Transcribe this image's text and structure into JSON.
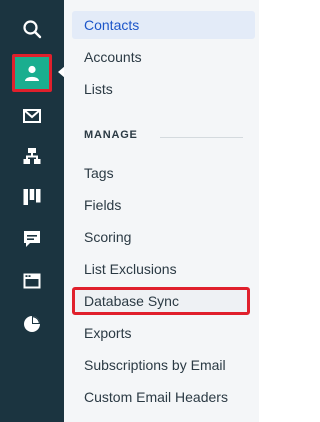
{
  "rail": {
    "icons": [
      "search-icon",
      "contacts-person-icon",
      "mail-icon",
      "automation-tree-icon",
      "deals-columns-icon",
      "chat-message-icon",
      "site-window-icon",
      "reports-pie-icon"
    ]
  },
  "menu": {
    "items": [
      {
        "label": "Contacts"
      },
      {
        "label": "Accounts"
      },
      {
        "label": "Lists"
      }
    ],
    "manage_title": "MANAGE",
    "manage_items": [
      {
        "label": "Tags"
      },
      {
        "label": "Fields"
      },
      {
        "label": "Scoring"
      },
      {
        "label": "List Exclusions"
      },
      {
        "label": "Database Sync"
      },
      {
        "label": "Exports"
      },
      {
        "label": "Subscriptions by Email"
      },
      {
        "label": "Custom Email Headers"
      }
    ]
  },
  "colors": {
    "rail_bg": "#1b3440",
    "accent": "#1aae8f",
    "highlight_border": "#e0202c",
    "selected_text": "#1d56c9"
  }
}
